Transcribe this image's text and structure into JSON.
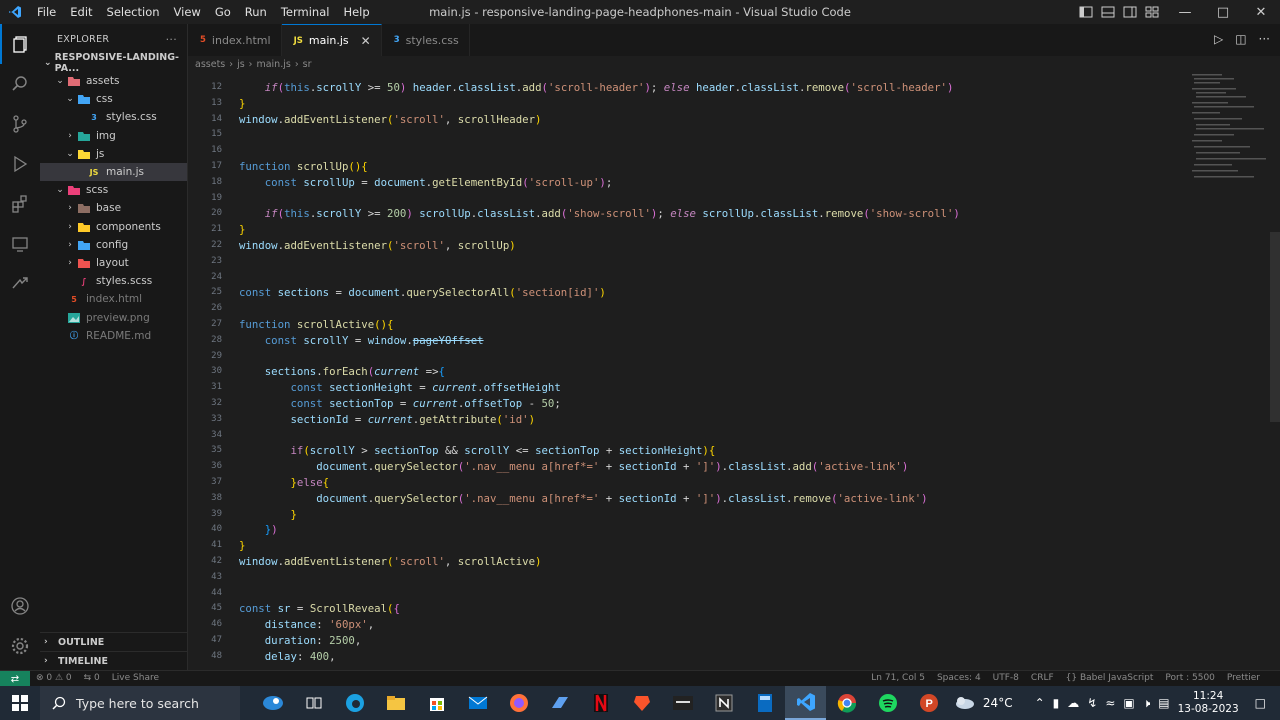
{
  "window": {
    "title": "main.js - responsive-landing-page-headphones-main - Visual Studio Code",
    "menu": [
      "File",
      "Edit",
      "Selection",
      "View",
      "Go",
      "Run",
      "Terminal",
      "Help"
    ]
  },
  "sidebar": {
    "title": "EXPLORER",
    "root": "RESPONSIVE-LANDING-PA...",
    "tree": [
      {
        "label": "assets",
        "depth": 1,
        "type": "folder-open",
        "icon_color": "#e06c75"
      },
      {
        "label": "css",
        "depth": 2,
        "type": "folder-open",
        "icon_color": "#42a5f5"
      },
      {
        "label": "styles.css",
        "depth": 3,
        "type": "css"
      },
      {
        "label": "img",
        "depth": 2,
        "type": "folder",
        "icon_color": "#26a69a"
      },
      {
        "label": "js",
        "depth": 2,
        "type": "folder-open",
        "icon_color": "#fdd835"
      },
      {
        "label": "main.js",
        "depth": 3,
        "type": "js",
        "selected": true
      },
      {
        "label": "scss",
        "depth": 1,
        "type": "folder-open",
        "icon_color": "#ec407a"
      },
      {
        "label": "base",
        "depth": 2,
        "type": "folder",
        "icon_color": "#8d6e63"
      },
      {
        "label": "components",
        "depth": 2,
        "type": "folder",
        "icon_color": "#ffca28"
      },
      {
        "label": "config",
        "depth": 2,
        "type": "folder",
        "icon_color": "#42a5f5"
      },
      {
        "label": "layout",
        "depth": 2,
        "type": "folder",
        "icon_color": "#ef5350"
      },
      {
        "label": "styles.scss",
        "depth": 2,
        "type": "scss"
      },
      {
        "label": "index.html",
        "depth": 1,
        "type": "html"
      },
      {
        "label": "preview.png",
        "depth": 1,
        "type": "png"
      },
      {
        "label": "README.md",
        "depth": 1,
        "type": "md"
      }
    ],
    "outline": "OUTLINE",
    "timeline": "TIMELINE"
  },
  "tabs": [
    {
      "label": "index.html",
      "icon": "html-file-icon",
      "active": false
    },
    {
      "label": "main.js",
      "icon": "js-file-icon",
      "active": true
    },
    {
      "label": "styles.css",
      "icon": "css-file-icon",
      "active": false
    }
  ],
  "breadcrumb": [
    "assets",
    "js",
    "main.js",
    "sr"
  ],
  "editor": {
    "lines": [
      {
        "n": "12",
        "html": "    <span class=\"ital\">if</span><span class=\"br2\">(</span><span class=\"kw\">this</span><span class=\"pln\">.</span><span class=\"var\">scrollY</span><span class=\"pln\"> &gt;= </span><span class=\"num\">50</span><span class=\"br2\">)</span><span class=\"pln\"> </span><span class=\"var\">header</span><span class=\"pln\">.</span><span class=\"var\">classList</span><span class=\"pln\">.</span><span class=\"fn\">add</span><span class=\"br2\">(</span><span class=\"str\">'scroll-header'</span><span class=\"br2\">)</span><span class=\"pln\">; </span><span class=\"ital\">else</span><span class=\"pln\"> </span><span class=\"var\">header</span><span class=\"pln\">.</span><span class=\"var\">classList</span><span class=\"pln\">.</span><span class=\"fn\">remove</span><span class=\"br2\">(</span><span class=\"str\">'scroll-header'</span><span class=\"br2\">)</span>"
      },
      {
        "n": "13",
        "html": "<span class=\"br1\">}</span>"
      },
      {
        "n": "14",
        "html": "<span class=\"var\">window</span><span class=\"pln\">.</span><span class=\"fn\">addEventListener</span><span class=\"br1\">(</span><span class=\"str\">'scroll'</span><span class=\"pln\">, </span><span class=\"fn\">scrollHeader</span><span class=\"br1\">)</span>"
      },
      {
        "n": "15",
        "html": ""
      },
      {
        "n": "16",
        "html": ""
      },
      {
        "n": "17",
        "html": "<span class=\"kw\">function</span><span class=\"pln\"> </span><span class=\"fn\">scrollUp</span><span class=\"br1\">()</span><span class=\"br1\">{</span>"
      },
      {
        "n": "18",
        "html": "    <span class=\"kw\">const</span><span class=\"pln\"> </span><span class=\"var\">scrollUp</span><span class=\"pln\"> = </span><span class=\"var\">document</span><span class=\"pln\">.</span><span class=\"fn\">getElementById</span><span class=\"br2\">(</span><span class=\"str\">'scroll-up'</span><span class=\"br2\">)</span><span class=\"pln\">;</span>"
      },
      {
        "n": "19",
        "html": ""
      },
      {
        "n": "20",
        "html": "    <span class=\"ital\">if</span><span class=\"br2\">(</span><span class=\"kw\">this</span><span class=\"pln\">.</span><span class=\"var\">scrollY</span><span class=\"pln\"> &gt;= </span><span class=\"num\">200</span><span class=\"br2\">)</span><span class=\"pln\"> </span><span class=\"var\">scrollUp</span><span class=\"pln\">.</span><span class=\"var\">classList</span><span class=\"pln\">.</span><span class=\"fn\">add</span><span class=\"br2\">(</span><span class=\"str\">'show-scroll'</span><span class=\"br2\">)</span><span class=\"pln\">; </span><span class=\"ital\">else</span><span class=\"pln\"> </span><span class=\"var\">scrollUp</span><span class=\"pln\">.</span><span class=\"var\">classList</span><span class=\"pln\">.</span><span class=\"fn\">remove</span><span class=\"br2\">(</span><span class=\"str\">'show-scroll'</span><span class=\"br2\">)</span>"
      },
      {
        "n": "21",
        "html": "<span class=\"br1\">}</span>"
      },
      {
        "n": "22",
        "html": "<span class=\"var\">window</span><span class=\"pln\">.</span><span class=\"fn\">addEventListener</span><span class=\"br1\">(</span><span class=\"str\">'scroll'</span><span class=\"pln\">, </span><span class=\"fn\">scrollUp</span><span class=\"br1\">)</span>"
      },
      {
        "n": "23",
        "html": ""
      },
      {
        "n": "24",
        "html": ""
      },
      {
        "n": "25",
        "html": "<span class=\"kw\">const</span><span class=\"pln\"> </span><span class=\"var\">sections</span><span class=\"pln\"> = </span><span class=\"var\">document</span><span class=\"pln\">.</span><span class=\"fn\">querySelectorAll</span><span class=\"br1\">(</span><span class=\"str\">'section[id]'</span><span class=\"br1\">)</span>"
      },
      {
        "n": "26",
        "html": ""
      },
      {
        "n": "27",
        "html": "<span class=\"kw\">function</span><span class=\"pln\"> </span><span class=\"fn\">scrollActive</span><span class=\"br1\">()</span><span class=\"br1\">{</span>"
      },
      {
        "n": "28",
        "html": "    <span class=\"kw\">const</span><span class=\"pln\"> </span><span class=\"var\">scrollY</span><span class=\"pln\"> = </span><span class=\"var\">window</span><span class=\"pln\">.</span><span class=\"var strike\">pageYOffset</span>"
      },
      {
        "n": "29",
        "html": ""
      },
      {
        "n": "30",
        "html": "    <span class=\"var\">sections</span><span class=\"pln\">.</span><span class=\"fn\">forEach</span><span class=\"br2\">(</span><span class=\"prm\">current</span><span class=\"pln\"> =&gt;</span><span class=\"br3\">{</span>"
      },
      {
        "n": "31",
        "html": "        <span class=\"kw\">const</span><span class=\"pln\"> </span><span class=\"var\">sectionHeight</span><span class=\"pln\"> = </span><span class=\"prm\">current</span><span class=\"pln\">.</span><span class=\"var\">offsetHeight</span>"
      },
      {
        "n": "32",
        "html": "        <span class=\"kw\">const</span><span class=\"pln\"> </span><span class=\"var\">sectionTop</span><span class=\"pln\"> = </span><span class=\"prm\">current</span><span class=\"pln\">.</span><span class=\"var\">offsetTop</span><span class=\"pln\"> - </span><span class=\"num\">50</span><span class=\"pln\">;</span>"
      },
      {
        "n": "33",
        "html": "        <span class=\"var\">sectionId</span><span class=\"pln\"> = </span><span class=\"prm\">current</span><span class=\"pln\">.</span><span class=\"fn\">getAttribute</span><span class=\"br1\">(</span><span class=\"str\">'id'</span><span class=\"br1\">)</span>"
      },
      {
        "n": "34",
        "html": ""
      },
      {
        "n": "35",
        "html": "        <span class=\"ctl\">if</span><span class=\"br1\">(</span><span class=\"var\">scrollY</span><span class=\"pln\"> &gt; </span><span class=\"var\">sectionTop</span><span class=\"pln\"> &amp;&amp; </span><span class=\"var\">scrollY</span><span class=\"pln\"> &lt;= </span><span class=\"var\">sectionTop</span><span class=\"pln\"> + </span><span class=\"var\">sectionHeight</span><span class=\"br1\">)</span><span class=\"br1\">{</span>"
      },
      {
        "n": "36",
        "html": "            <span class=\"var\">document</span><span class=\"pln\">.</span><span class=\"fn\">querySelector</span><span class=\"br2\">(</span><span class=\"str\">'.nav__menu a[href*='</span><span class=\"pln\"> + </span><span class=\"var\">sectionId</span><span class=\"pln\"> + </span><span class=\"str\">']'</span><span class=\"br2\">)</span><span class=\"pln\">.</span><span class=\"var\">classList</span><span class=\"pln\">.</span><span class=\"fn\">add</span><span class=\"br2\">(</span><span class=\"str\">'active-link'</span><span class=\"br2\">)</span>"
      },
      {
        "n": "37",
        "html": "        <span class=\"br1\">}</span><span class=\"ctl\">else</span><span class=\"br1\">{</span>"
      },
      {
        "n": "38",
        "html": "            <span class=\"var\">document</span><span class=\"pln\">.</span><span class=\"fn\">querySelector</span><span class=\"br2\">(</span><span class=\"str\">'.nav__menu a[href*='</span><span class=\"pln\"> + </span><span class=\"var\">sectionId</span><span class=\"pln\"> + </span><span class=\"str\">']'</span><span class=\"br2\">)</span><span class=\"pln\">.</span><span class=\"var\">classList</span><span class=\"pln\">.</span><span class=\"fn\">remove</span><span class=\"br2\">(</span><span class=\"str\">'active-link'</span><span class=\"br2\">)</span>"
      },
      {
        "n": "39",
        "html": "        <span class=\"br1\">}</span>"
      },
      {
        "n": "40",
        "html": "    <span class=\"br3\">}</span><span class=\"br2\">)</span>"
      },
      {
        "n": "41",
        "html": "<span class=\"br1\">}</span>"
      },
      {
        "n": "42",
        "html": "<span class=\"var\">window</span><span class=\"pln\">.</span><span class=\"fn\">addEventListener</span><span class=\"br1\">(</span><span class=\"str\">'scroll'</span><span class=\"pln\">, </span><span class=\"fn\">scrollActive</span><span class=\"br1\">)</span>"
      },
      {
        "n": "43",
        "html": ""
      },
      {
        "n": "44",
        "html": ""
      },
      {
        "n": "45",
        "html": "<span class=\"kw\">const</span><span class=\"pln\"> </span><span class=\"var\">sr</span><span class=\"pln\"> = </span><span class=\"fn\">ScrollReveal</span><span class=\"br1\">(</span><span class=\"br2\">{</span>"
      },
      {
        "n": "46",
        "html": "    <span class=\"var\">distance</span><span class=\"pln\">: </span><span class=\"str\">'60px'</span><span class=\"pln\">,</span>"
      },
      {
        "n": "47",
        "html": "    <span class=\"var\">duration</span><span class=\"pln\">: </span><span class=\"num\">2500</span><span class=\"pln\">,</span>"
      },
      {
        "n": "48",
        "html": "    <span class=\"var\">delay</span><span class=\"pln\">: </span><span class=\"num\">400</span><span class=\"pln\">,</span>"
      }
    ]
  },
  "statusbar": {
    "left": [
      "⊗ 0 ⚠ 0",
      "⇆ 0",
      "Live Share"
    ],
    "right": [
      "Ln 71, Col 5",
      "Spaces: 4",
      "UTF-8",
      "CRLF",
      "{} Babel JavaScript",
      "Port : 5500",
      "Prettier"
    ]
  },
  "taskbar": {
    "search_placeholder": "Type here to search",
    "weather": "24°C",
    "time": "11:24",
    "date": "13-08-2023"
  },
  "colors": {
    "accent": "#0078d4",
    "remote": "#16825d"
  }
}
